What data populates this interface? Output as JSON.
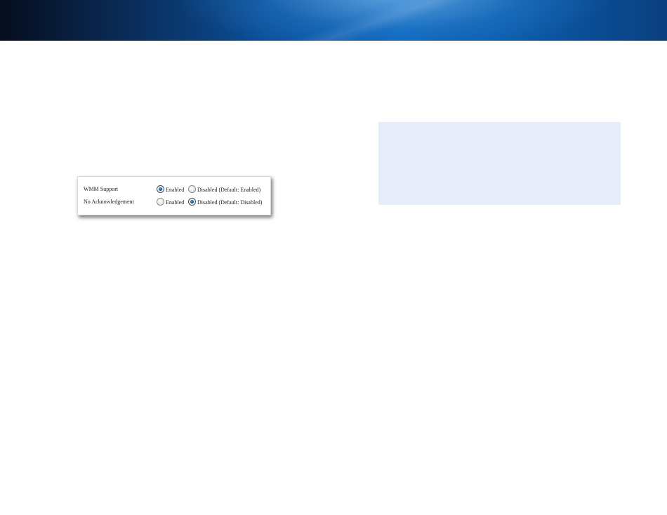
{
  "colors": {
    "banner_primary": "#0b4f99",
    "banner_dark": "#050d1e",
    "info_box_background": "#e6ecf8",
    "radio_selected": "#1e5a8a"
  },
  "settings_panel": {
    "wmm_support": {
      "label": "WMM Support",
      "options": [
        {
          "label": "Enabled",
          "selected": true
        },
        {
          "label": "Disabled (Default: Enabled)",
          "selected": false
        }
      ]
    },
    "no_acknowledgement": {
      "label": "No Acknowledgement",
      "options": [
        {
          "label": "Enabled",
          "selected": false
        },
        {
          "label": "Disabled (Default: Disabled)",
          "selected": true
        }
      ]
    }
  },
  "info_box": {
    "text": ""
  }
}
